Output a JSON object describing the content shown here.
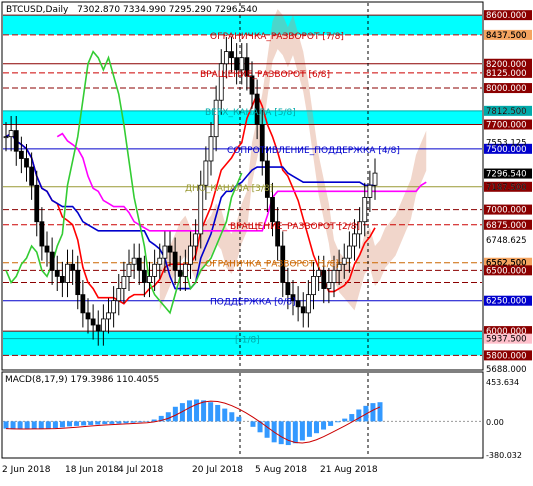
{
  "header": {
    "symbol": "BTCUSD,Daily",
    "ohlc": "7302.870 7334.990 7295.290 7296.540"
  },
  "colors": {
    "background": "#ffffff",
    "candle": "#000000",
    "ichimoku_cloud": "#d88a6a",
    "tenkan": "#ff0000",
    "kijun": "#0000cc",
    "chikou": "#33cc33",
    "senkou_b": "#ff00ff",
    "murrey_line": "#8b0000",
    "murrey_label": "#cc0000",
    "zone_cyan": "#00ffff",
    "price_tag": "#000000",
    "macd_hist": "#3399ff",
    "macd_signal": "#cc0000"
  },
  "murrey_levels": [
    {
      "price": 8600,
      "tag": "8600.000",
      "label": "",
      "style": "solid",
      "color": "#8b0000"
    },
    {
      "price": 8437.5,
      "tag": "8437.500",
      "label": "ОГРАНИЧКА_РАЗВОРОТ [7/8]",
      "style": "dashed",
      "color": "#cc0000",
      "tag_bg": "#f4a460"
    },
    {
      "price": 8200,
      "tag": "8200.000",
      "label": "",
      "style": "solid",
      "color": "#8b0000"
    },
    {
      "price": 8125,
      "tag": "8125.000",
      "label": "ВРАЩЕНИЕ_РАЗВОРОТ [6/8]",
      "style": "dashed",
      "color": "#cc0000"
    },
    {
      "price": 8000,
      "tag": "8000.000",
      "label": "",
      "style": "dashed",
      "color": "#8b0000"
    },
    {
      "price": 7812.5,
      "tag": "7812.500",
      "label": "ВЕРХ_КАНАЛА [5/8]",
      "style": "solid",
      "color": "#00aaaa"
    },
    {
      "price": 7700,
      "tag": "7700.000",
      "label": "",
      "style": "solid",
      "color": "#8b0000"
    },
    {
      "price": 7500,
      "tag": "7500.000",
      "label": "СОПРОТИВЛЕНИЕ_ПОДДЕРЖКА [4/8]",
      "style": "solid",
      "color": "#0000cc"
    },
    {
      "price": 7187.5,
      "tag": "7187.500",
      "label": "ДНО_КАНАЛА [3/8]",
      "style": "solid",
      "color": "#999933"
    },
    {
      "price": 7000,
      "tag": "7000.000",
      "label": "",
      "style": "dashed",
      "color": "#8b0000"
    },
    {
      "price": 6875,
      "tag": "6875.000",
      "label": "ВРАЩЕНИЕ_РАЗВОРОТ [2/8]",
      "style": "dashed",
      "color": "#cc0000"
    },
    {
      "price": 6562.5,
      "tag": "6562.500",
      "label": "ОГРАНИЧКА_РАЗВОРОТ [1/8]",
      "style": "dashed",
      "color": "#cc6600",
      "tag_bg": "#f4a460"
    },
    {
      "price": 6500,
      "tag": "6500.000",
      "label": "",
      "style": "dashed",
      "color": "#8b0000"
    },
    {
      "price": 6400,
      "tag": "",
      "label": "",
      "style": "dashed",
      "color": "#8b0000"
    },
    {
      "price": 6250,
      "tag": "6250.000",
      "label": "ПОДДЕРЖКА [0/8]",
      "style": "solid",
      "color": "#0000cc"
    },
    {
      "price": 6000,
      "tag": "6000.000",
      "label": "",
      "style": "solid",
      "color": "#8b0000"
    },
    {
      "price": 5937.5,
      "tag": "5937.500",
      "label": "[-1/8]",
      "style": "solid",
      "color": "#00aaaa",
      "tag_bg": "#ffc0cb"
    },
    {
      "price": 5800,
      "tag": "5800.000",
      "label": "",
      "style": "dashed",
      "color": "#8b0000"
    }
  ],
  "price_axis_ticks": [
    "8437.500",
    "7812.500",
    "7553.125",
    "7187.500",
    "6748.625",
    "6562.500",
    "5688.000"
  ],
  "price_current": "7296.540",
  "chart_data": [
    {
      "type": "candlestick",
      "title": "BTCUSD,Daily",
      "x": [
        "2 Jun 2018",
        "18 Jun 2018",
        "4 Jul 2018",
        "20 Jul 2018",
        "5 Aug 2018",
        "21 Aug 2018"
      ],
      "ylim": [
        5688,
        8700
      ],
      "series": [
        {
          "name": "",
          "values": [
            7600,
            7650,
            7480,
            7420,
            7350,
            7200,
            6900,
            6700,
            6650,
            6500,
            6450,
            6400,
            6550,
            6500,
            6300,
            6150,
            6100,
            6050,
            6000,
            6100,
            6150,
            6250,
            6350,
            6450,
            6550,
            6600,
            6500,
            6400,
            6450,
            6550,
            6600,
            6700,
            6650,
            6500,
            6450,
            6550,
            6700,
            6800,
            7200,
            7400,
            7600,
            7900,
            8200,
            8300,
            8250,
            8150,
            8250,
            8100,
            7950,
            7700,
            7400,
            7100,
            6900,
            6700,
            6400,
            6300,
            6250,
            6200,
            6150,
            6300,
            6450,
            6500,
            6350,
            6400,
            6500,
            6550,
            6600,
            6700,
            6800,
            6900,
            7100,
            7200,
            7300
          ]
        }
      ]
    },
    {
      "type": "bar",
      "title": "MACD(8,17,9) 179.3986 110.4055",
      "ylim": [
        -380.032,
        453.634
      ],
      "series": [
        {
          "name": "",
          "values": [
            -80,
            -85,
            -85,
            -85,
            -80,
            -80,
            -78,
            -75,
            -65,
            -55,
            -50,
            -45,
            -40,
            -35,
            -30,
            -28,
            -25,
            -20,
            -15,
            -10,
            -5,
            20,
            60,
            100,
            160,
            200,
            230,
            240,
            230,
            210,
            180,
            140,
            100,
            50,
            0,
            -60,
            -120,
            -180,
            -230,
            -250,
            -260,
            -240,
            -210,
            -170,
            -130,
            -90,
            -50,
            -10,
            30,
            80,
            130,
            170,
            200,
            210
          ]
        }
      ]
    }
  ],
  "macd_axis": {
    "label": "MACD(8,17,9) 179.3986 110.4055",
    "top": "453.634",
    "zero": "0.00",
    "bottom": "-380.032"
  },
  "date_axis": [
    "2 Jun 2018",
    "18 Jun 2018",
    "4 Jul 2018",
    "20 Jul 2018",
    "5 Aug 2018",
    "21 Aug 2018"
  ]
}
